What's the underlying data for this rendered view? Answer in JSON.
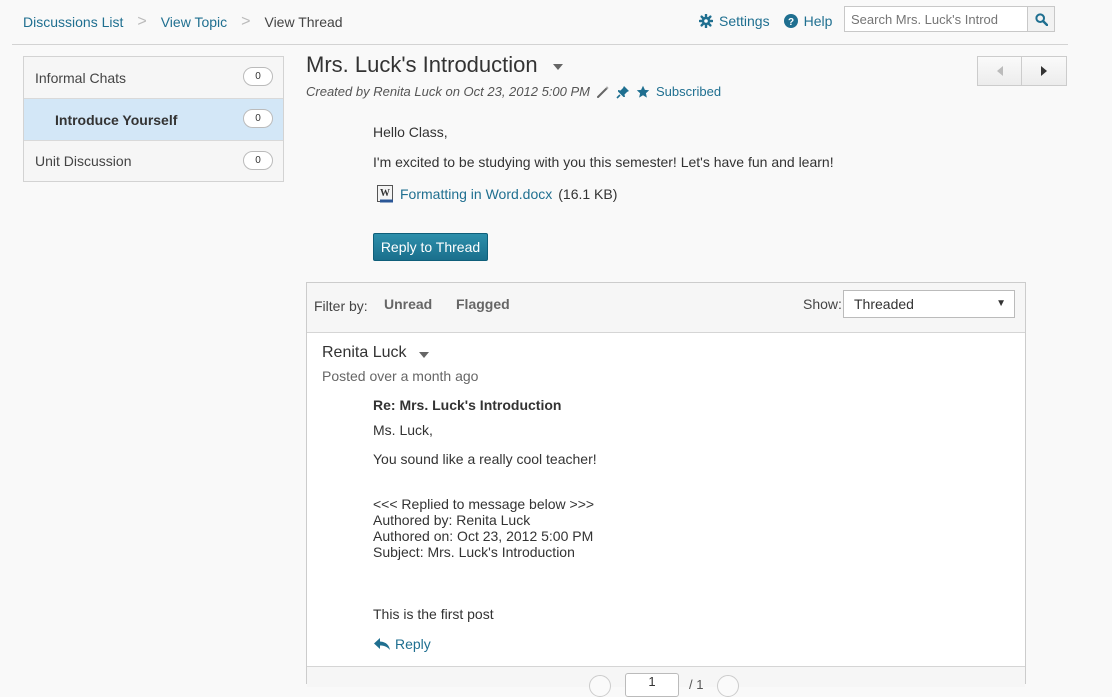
{
  "breadcrumb": {
    "items": [
      {
        "label": "Discussions List"
      },
      {
        "label": "View Topic"
      },
      {
        "label": "View Thread"
      }
    ]
  },
  "toolbar": {
    "settings_label": "Settings",
    "help_label": "Help",
    "search_placeholder": "Search Mrs. Luck's Introd"
  },
  "sidebar": {
    "items": [
      {
        "label": "Informal Chats",
        "count": "0"
      },
      {
        "label": "Introduce Yourself",
        "count": "0"
      },
      {
        "label": "Unit Discussion",
        "count": "0"
      }
    ]
  },
  "thread": {
    "title": "Mrs. Luck's Introduction",
    "meta": "Created by Renita Luck on Oct 23, 2012 5:00 PM",
    "subscribed_label": "Subscribed",
    "body": {
      "greeting": "Hello Class,",
      "text": "I'm excited to be studying with you this semester!  Let's have fun and learn!"
    },
    "attachment": {
      "name": "Formatting in Word.docx",
      "size": "(16.1 KB)"
    },
    "reply_button": "Reply to Thread"
  },
  "filterbar": {
    "filter_label": "Filter by:",
    "unread_label": "Unread",
    "flagged_label": "Flagged",
    "show_label": "Show:",
    "show_value": "Threaded"
  },
  "reply": {
    "author": "Renita Luck",
    "posted": "Posted over a month ago",
    "subject": "Re: Mrs. Luck's Introduction",
    "lines": {
      "salutation": "Ms. Luck,",
      "message": "You sound like a really cool teacher!",
      "quote_header": "<<< Replied to message below >>>",
      "authored_by": "Authored by: Renita Luck",
      "authored_on": "Authored on: Oct 23, 2012 5:00 PM",
      "quote_subject": "Subject: Mrs. Luck's Introduction",
      "quote_body": "This is the first post"
    },
    "reply_label": "Reply"
  },
  "pager": {
    "current_page": "1",
    "total": "/ 1"
  }
}
